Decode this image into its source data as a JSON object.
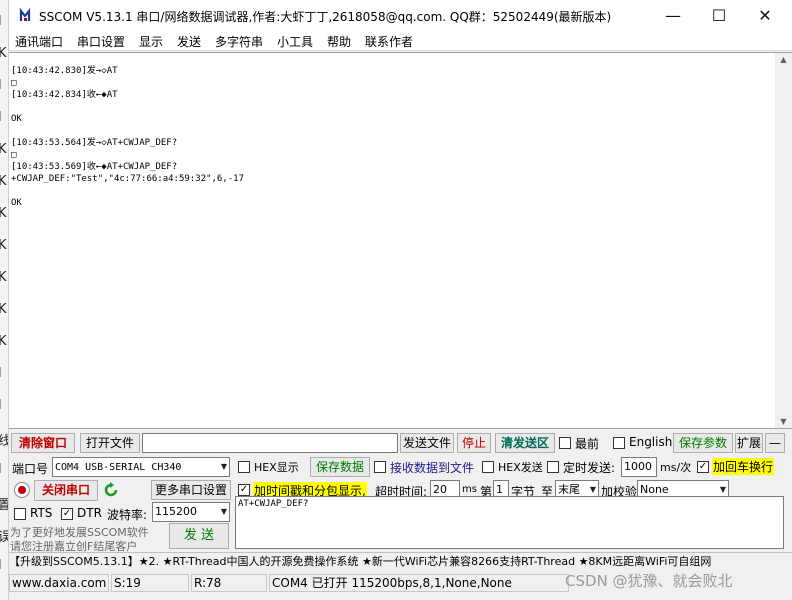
{
  "left_strip": [
    "l",
    "K",
    "l",
    "l",
    "K",
    "K",
    "K",
    "K",
    "K",
    "K",
    "K",
    "l",
    "l",
    "线",
    "l",
    "置",
    "误",
    "l"
  ],
  "title": "SSCOM V5.13.1 串口/网络数据调试器,作者:大虾丁丁,2618058@qq.com. QQ群：52502449(最新版本)",
  "window_buttons": {
    "minimize": "—",
    "maximize": "☐",
    "close": "✕"
  },
  "menu": [
    "通讯端口",
    "串口设置",
    "显示",
    "发送",
    "多字符串",
    "小工具",
    "帮助",
    "联系作者"
  ],
  "receive": {
    "lines": [
      "[10:43:42.830]发→◇AT",
      "□",
      "[10:43:42.834]收←◆AT",
      "",
      "OK",
      "",
      "[10:43:53.564]发→◇AT+CWJAP_DEF?",
      "□",
      "[10:43:53.569]收←◆AT+CWJAP_DEF?",
      "+CWJAP_DEF:\"Test\",\"4c:77:66:a4:59:32\",6,-17",
      "",
      "OK"
    ]
  },
  "row1": {
    "clear_window": "清除窗口",
    "open_file": "打开文件",
    "file_path": "",
    "send_file": "发送文件",
    "stop": "停止",
    "clear_send": "清发送区",
    "topmost": "最前",
    "english": "English",
    "save_params": "保存参数",
    "expand": "扩展",
    "collapse": "—"
  },
  "settings": {
    "port_label": "端口号",
    "port_value": "COM4 USB-SERIAL CH340",
    "hex_display": "HEX显示",
    "save_data": "保存数据",
    "recv_to_file": "接收数据到文件",
    "hex_send": "HEX发送",
    "timed_send": "定时发送:",
    "interval": "1000",
    "interval_unit": "ms/次",
    "add_newline": "加回车换行",
    "close_port": "关闭串口",
    "more_settings": "更多串口设置",
    "timestamp": "加时间戳和分包显示,",
    "timeout_label": "超时时间:",
    "timeout_value": "20",
    "ms": "ms",
    "nth_label": "第",
    "nth_value": "1",
    "byte_label": "字节",
    "to_label": "至",
    "to_value": "末尾",
    "checksum_label": "加校验",
    "checksum_value": "None",
    "rts": "RTS",
    "dtr": "DTR",
    "baud_label": "波特率:",
    "baud_value": "115200",
    "promo_line1": "为了更好地发展SSCOM软件",
    "promo_line2": "请您注册嘉立创F结尾客户",
    "send_button": "发  送",
    "send_text": "AT+CWJAP_DEF?"
  },
  "ticker": "【升级到SSCOM5.13.1】★2. ★RT-Thread中国人的开源免费操作系统 ★新一代WiFi芯片兼容8266支持RT-Thread ★8KM远距离WiFi可自组网",
  "status": {
    "website": "www.daxia.com",
    "sent": "S:19",
    "received": "R:78",
    "port_info": "COM4 已打开  115200bps,8,1,None,None"
  },
  "watermark": "CSDN @犹豫、就会败北"
}
